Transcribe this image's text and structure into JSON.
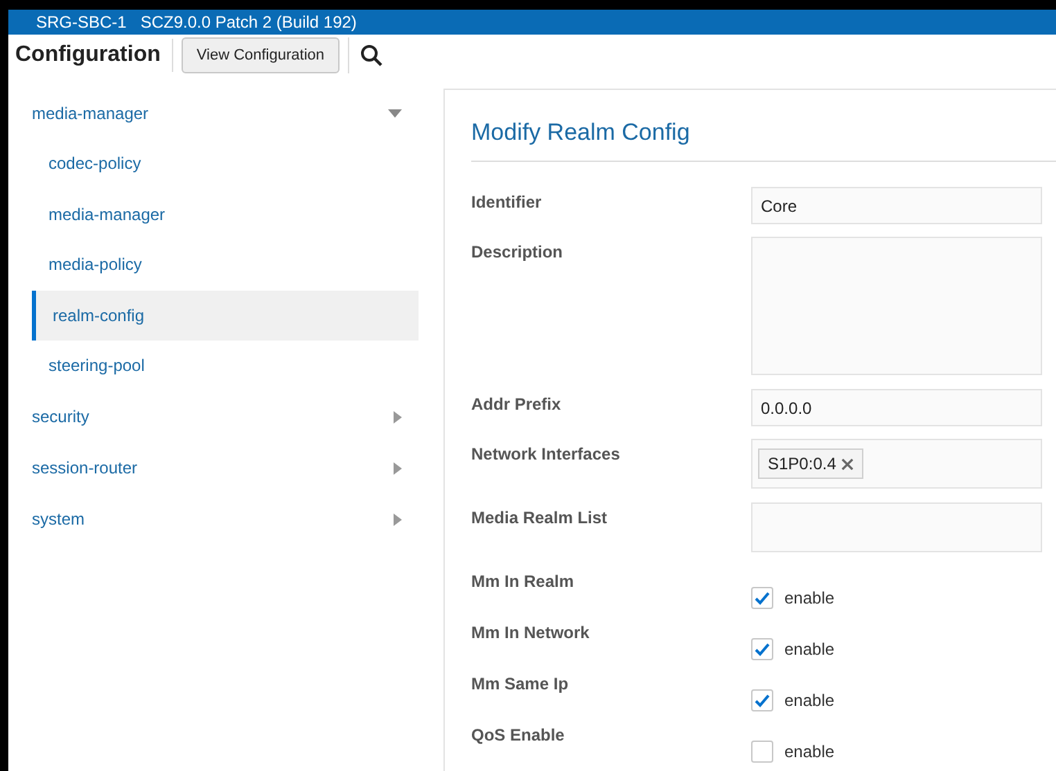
{
  "top_bar": {
    "device": "SRG-SBC-1",
    "version": "SCZ9.0.0 Patch 2 (Build 192)"
  },
  "header": {
    "title": "Configuration",
    "view_button": "View Configuration"
  },
  "sidebar": {
    "items": [
      {
        "label": "media-manager",
        "expanded": true,
        "children": [
          {
            "label": "codec-policy",
            "selected": false
          },
          {
            "label": "media-manager",
            "selected": false
          },
          {
            "label": "media-policy",
            "selected": false
          },
          {
            "label": "realm-config",
            "selected": true
          },
          {
            "label": "steering-pool",
            "selected": false
          }
        ]
      },
      {
        "label": "security",
        "expanded": false
      },
      {
        "label": "session-router",
        "expanded": false
      },
      {
        "label": "system",
        "expanded": false
      }
    ]
  },
  "form": {
    "title": "Modify Realm Config",
    "fields": [
      {
        "kind": "text",
        "label": "Identifier",
        "value": "Core"
      },
      {
        "kind": "textarea",
        "label": "Description"
      },
      {
        "kind": "text",
        "label": "Addr Prefix",
        "value": "0.0.0.0"
      },
      {
        "kind": "tags",
        "label": "Network Interfaces",
        "tags": [
          "S1P0:0.4"
        ]
      },
      {
        "kind": "tags",
        "label": "Media Realm List"
      },
      {
        "kind": "checkbox",
        "label": "Mm In Realm",
        "checked": true,
        "text": "enable"
      },
      {
        "kind": "checkbox",
        "label": "Mm In Network",
        "checked": true,
        "text": "enable"
      },
      {
        "kind": "checkbox",
        "label": "Mm Same Ip",
        "checked": true,
        "text": "enable"
      },
      {
        "kind": "checkbox",
        "label": "QoS Enable",
        "checked": false,
        "text": "enable"
      }
    ]
  }
}
